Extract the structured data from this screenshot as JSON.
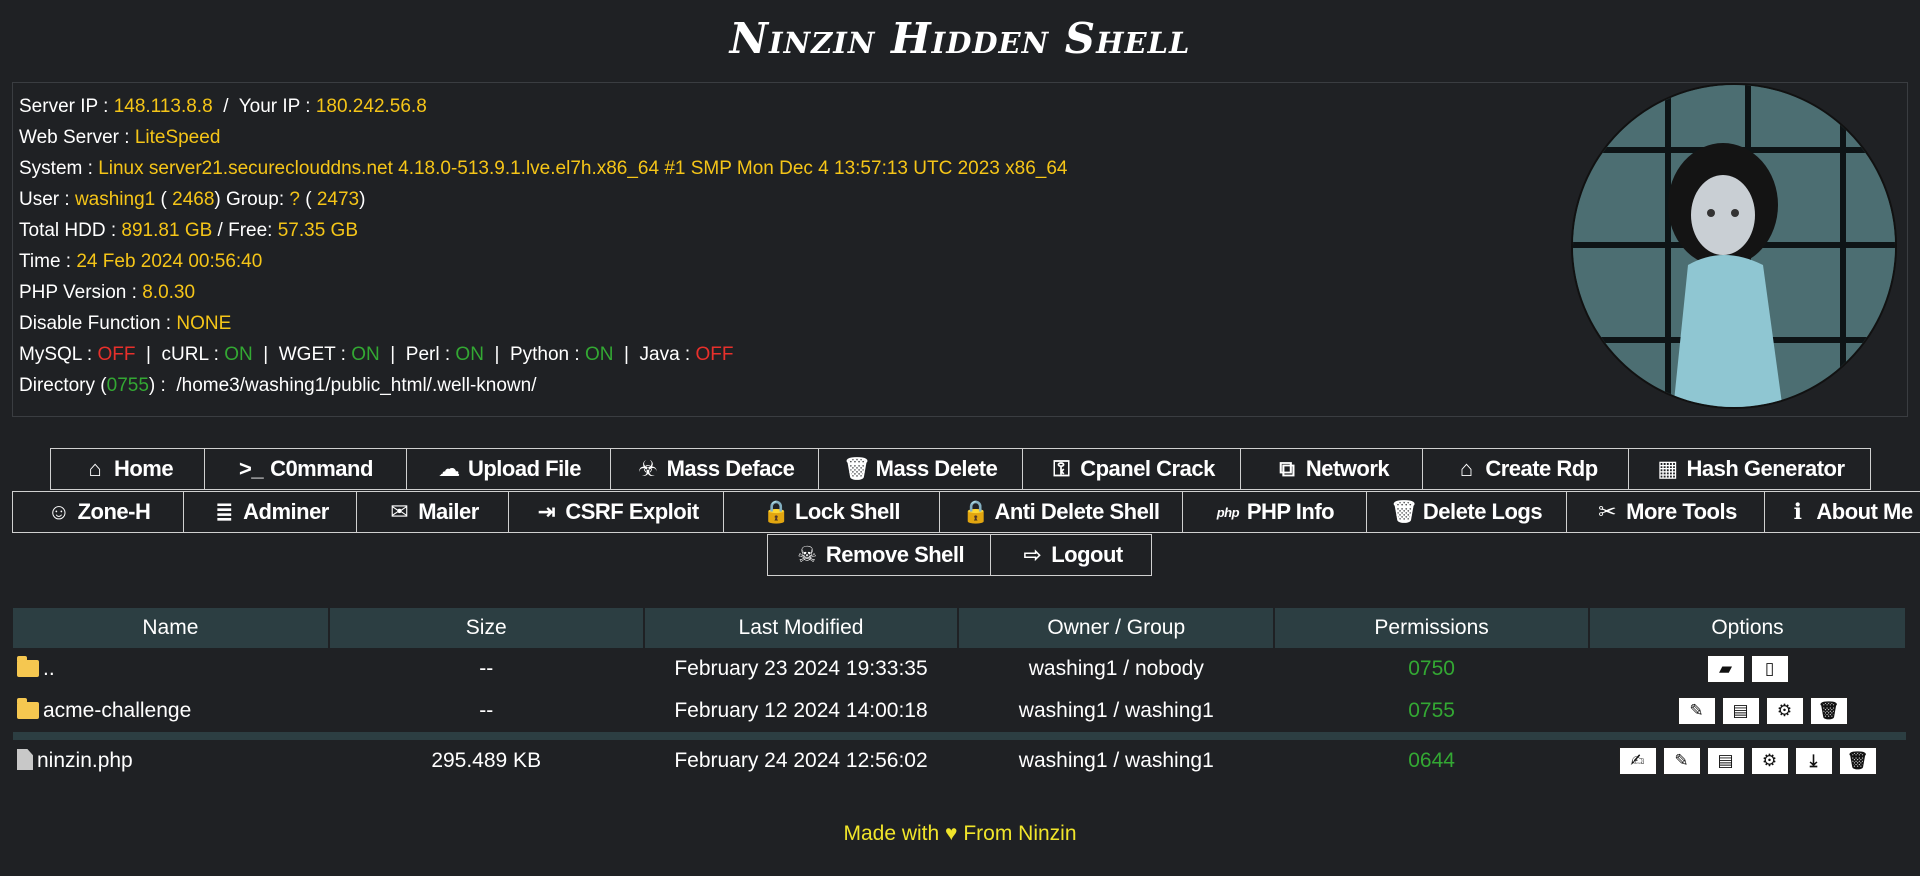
{
  "title": "Ninzin Hidden Shell",
  "info": {
    "server_ip_label": "Server IP : ",
    "server_ip": "148.113.8.8",
    "your_ip_label": "  /  Your IP : ",
    "your_ip": "180.242.56.8",
    "web_server_label": "Web Server : ",
    "web_server": "LiteSpeed",
    "system_label": "System : ",
    "system": "Linux server21.secureclouddns.net 4.18.0-513.9.1.lve.el7h.x86_64 #1 SMP Mon Dec 4 13:57:13 UTC 2023 x86_64",
    "user_label": "User : ",
    "user": "washing1",
    "uid_open": " ( ",
    "uid": "2468",
    "group_label": ") Group: ",
    "group": "?",
    "gid_open": " ( ",
    "gid": "2473",
    "gid_close": ")",
    "hdd_label": "Total HDD : ",
    "hdd_total": "891.81 GB",
    "free_label": " / Free: ",
    "hdd_free": "57.35 GB",
    "time_label": "Time : ",
    "time": "24 Feb 2024 00:56:40",
    "php_label": "PHP Version : ",
    "php": "8.0.30",
    "disable_label": "Disable Function : ",
    "disable": "NONE",
    "mysql_label": "MySQL : ",
    "mysql": "OFF",
    "curl_label": "  |  cURL : ",
    "curl": "ON",
    "wget_label": "  |  WGET : ",
    "wget": "ON",
    "perl_label": "  |  Perl : ",
    "perl": "ON",
    "python_label": "  |  Python : ",
    "python": "ON",
    "java_label": "  |  Java : ",
    "java": "OFF",
    "dir_label": "Directory (",
    "dir_perm": "0755",
    "dir_sep": ") :  ",
    "dir_path": "/home3/washing1/public_html/.well-known/"
  },
  "menu_row1": [
    {
      "label": "Home",
      "icon": "home-icon"
    },
    {
      "label": "C0mmand",
      "icon": "terminal-icon"
    },
    {
      "label": "Upload File",
      "icon": "cloud-upload-icon"
    },
    {
      "label": "Mass Deface",
      "icon": "biohazard-icon"
    },
    {
      "label": "Mass Delete",
      "icon": "trash-icon"
    },
    {
      "label": "Cpanel Crack",
      "icon": "key-icon"
    },
    {
      "label": "Network",
      "icon": "network-icon"
    },
    {
      "label": "Create Rdp",
      "icon": "house-user-icon"
    },
    {
      "label": "Hash Generator",
      "icon": "calculator-icon"
    }
  ],
  "menu_row2": [
    {
      "label": "Zone-H",
      "icon": "mask-icon"
    },
    {
      "label": "Adminer",
      "icon": "database-icon"
    },
    {
      "label": "Mailer",
      "icon": "envelope-icon"
    },
    {
      "label": "CSRF Exploit",
      "icon": "file-import-icon"
    },
    {
      "label": "Lock Shell",
      "icon": "lock-icon"
    },
    {
      "label": "Anti Delete Shell",
      "icon": "lock-icon"
    },
    {
      "label": "PHP Info",
      "icon": "php-icon"
    },
    {
      "label": "Delete Logs",
      "icon": "trash-icon"
    },
    {
      "label": "More Tools",
      "icon": "tools-icon"
    },
    {
      "label": "About Me",
      "icon": "info-icon"
    }
  ],
  "menu_row3": [
    {
      "label": "Remove Shell",
      "icon": "skull-icon"
    },
    {
      "label": "Logout",
      "icon": "sign-out-icon"
    }
  ],
  "table": {
    "headers": [
      "Name",
      "Size",
      "Last Modified",
      "Owner / Group",
      "Permissions",
      "Options"
    ],
    "rows": [
      {
        "name": "..",
        "type": "folder",
        "size": "--",
        "modified": "February 23 2024 19:33:35",
        "owner": "washing1 / nobody",
        "perm": "0750"
      },
      {
        "name": "acme-challenge",
        "type": "folder",
        "size": "--",
        "modified": "February 12 2024 14:00:18",
        "owner": "washing1 / washing1",
        "perm": "0755"
      },
      {
        "name": "ninzin.php",
        "type": "file",
        "size": "295.489 KB",
        "modified": "February 24 2024 12:56:02",
        "owner": "washing1 / washing1",
        "perm": "0644"
      }
    ]
  },
  "footer": "Made with ♥ From Ninzin"
}
